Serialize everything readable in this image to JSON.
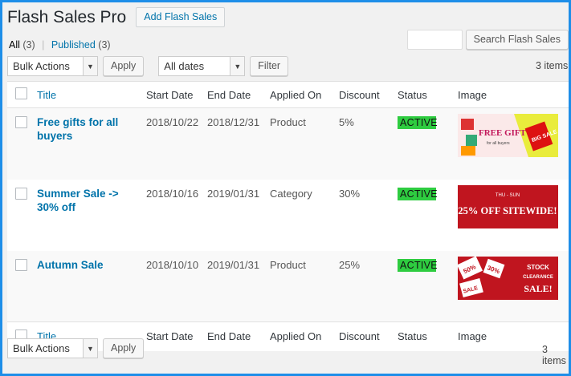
{
  "header": {
    "title": "Flash Sales Pro",
    "add_label": "Add Flash Sales"
  },
  "views": {
    "all_label": "All",
    "all_count": "(3)",
    "published_label": "Published",
    "published_count": "(3)",
    "separator": "|"
  },
  "search": {
    "button_label": "Search Flash Sales",
    "value": ""
  },
  "top_nav": {
    "bulk_actions": "Bulk Actions",
    "apply": "Apply",
    "date_filter": "All dates",
    "filter": "Filter",
    "items_count": "3 items"
  },
  "bottom_nav": {
    "bulk_actions": "Bulk Actions",
    "apply": "Apply",
    "items_count": "3 items"
  },
  "columns": [
    "Title",
    "Start Date",
    "End Date",
    "Applied On",
    "Discount",
    "Status",
    "Image"
  ],
  "rows": [
    {
      "title": "Free gifts for all buyers",
      "start": "2018/10/22",
      "end": "2018/12/31",
      "applied": "Product",
      "discount": "5%",
      "status": "ACTIVE",
      "image": {
        "text1": "FREE GIFT",
        "text2": "for all buyers",
        "tag": "BIG SALE"
      }
    },
    {
      "title": "Summer Sale -> 30% off",
      "start": "2018/10/16",
      "end": "2019/01/31",
      "applied": "Category",
      "discount": "30%",
      "status": "ACTIVE",
      "image": {
        "text1": "THU - SUN",
        "text2": "25% OFF SITEWIDE!"
      }
    },
    {
      "title": "Autumn Sale",
      "start": "2018/10/10",
      "end": "2019/01/31",
      "applied": "Product",
      "discount": "25%",
      "status": "ACTIVE",
      "image": {
        "text1": "STOCK",
        "text2": "CLEARANCE",
        "text3": "SALE!",
        "tag1": "50%",
        "tag2": "30%",
        "tag3": "SALE"
      }
    }
  ],
  "colors": {
    "frame": "#1e8ee8",
    "link": "#0073aa",
    "active": "#2ecc40",
    "banner_red": "#c0151f"
  }
}
